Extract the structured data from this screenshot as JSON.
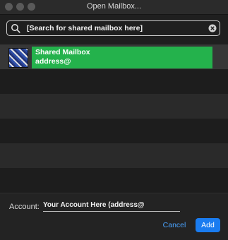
{
  "window": {
    "title": "Open Mailbox..."
  },
  "search": {
    "value": "[Search for shared mailbox here]"
  },
  "results": [
    {
      "name": "Shared Mailbox",
      "address": "address@"
    }
  ],
  "footer": {
    "account_label": "Account:",
    "account_value": "Your Account Here (address@",
    "cancel_label": "Cancel",
    "add_label": "Add"
  },
  "colors": {
    "accent": "#1a7cf0",
    "selection": "#24b24c",
    "background": "#1f1f1f"
  }
}
